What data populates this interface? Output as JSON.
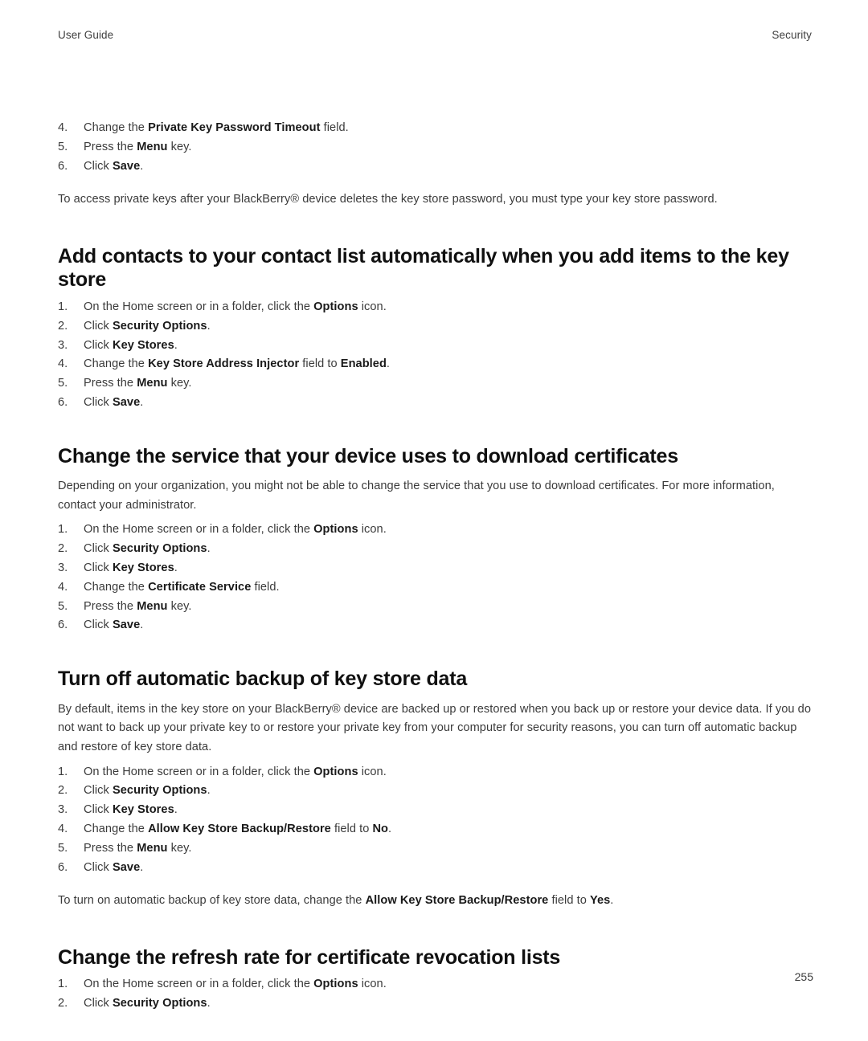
{
  "running_head": {
    "left": "User Guide",
    "right": "Security"
  },
  "page_number": "255",
  "sections": [
    {
      "id": "continued-steps",
      "heading": null,
      "steps": [
        {
          "num": "4.",
          "parts": [
            {
              "t": "Change the ",
              "b": false
            },
            {
              "t": "Private Key Password Timeout",
              "b": true
            },
            {
              "t": " field.",
              "b": false
            }
          ]
        },
        {
          "num": "5.",
          "parts": [
            {
              "t": "Press the ",
              "b": false
            },
            {
              "t": "Menu",
              "b": true
            },
            {
              "t": " key.",
              "b": false
            }
          ]
        },
        {
          "num": "6.",
          "parts": [
            {
              "t": "Click ",
              "b": false
            },
            {
              "t": "Save",
              "b": true
            },
            {
              "t": ".",
              "b": false
            }
          ]
        }
      ],
      "trailing_paragraph": "To access private keys after your BlackBerry® device deletes the key store password, you must type your key store password."
    },
    {
      "id": "add-contacts-automatically",
      "heading": "Add contacts to your contact list automatically when you add items to the key store",
      "intro": null,
      "steps": [
        {
          "num": "1.",
          "parts": [
            {
              "t": "On the Home screen or in a folder, click the ",
              "b": false
            },
            {
              "t": "Options",
              "b": true
            },
            {
              "t": " icon.",
              "b": false
            }
          ]
        },
        {
          "num": "2.",
          "parts": [
            {
              "t": "Click ",
              "b": false
            },
            {
              "t": "Security Options",
              "b": true
            },
            {
              "t": ".",
              "b": false
            }
          ]
        },
        {
          "num": "3.",
          "parts": [
            {
              "t": "Click ",
              "b": false
            },
            {
              "t": "Key Stores",
              "b": true
            },
            {
              "t": ".",
              "b": false
            }
          ]
        },
        {
          "num": "4.",
          "parts": [
            {
              "t": "Change the ",
              "b": false
            },
            {
              "t": "Key Store Address Injector",
              "b": true
            },
            {
              "t": " field to ",
              "b": false
            },
            {
              "t": "Enabled",
              "b": true
            },
            {
              "t": ".",
              "b": false
            }
          ]
        },
        {
          "num": "5.",
          "parts": [
            {
              "t": "Press the ",
              "b": false
            },
            {
              "t": "Menu",
              "b": true
            },
            {
              "t": " key.",
              "b": false
            }
          ]
        },
        {
          "num": "6.",
          "parts": [
            {
              "t": "Click ",
              "b": false
            },
            {
              "t": "Save",
              "b": true
            },
            {
              "t": ".",
              "b": false
            }
          ]
        }
      ],
      "trailing_paragraph": null
    },
    {
      "id": "change-certificate-download-service",
      "heading": "Change the service that your device uses to download certificates",
      "intro": "Depending on your organization, you might not be able to change the service that you use to download certificates. For more information, contact your administrator.",
      "steps": [
        {
          "num": "1.",
          "parts": [
            {
              "t": "On the Home screen or in a folder, click the ",
              "b": false
            },
            {
              "t": "Options",
              "b": true
            },
            {
              "t": " icon.",
              "b": false
            }
          ]
        },
        {
          "num": "2.",
          "parts": [
            {
              "t": "Click ",
              "b": false
            },
            {
              "t": "Security Options",
              "b": true
            },
            {
              "t": ".",
              "b": false
            }
          ]
        },
        {
          "num": "3.",
          "parts": [
            {
              "t": "Click ",
              "b": false
            },
            {
              "t": "Key Stores",
              "b": true
            },
            {
              "t": ".",
              "b": false
            }
          ]
        },
        {
          "num": "4.",
          "parts": [
            {
              "t": "Change the ",
              "b": false
            },
            {
              "t": "Certificate Service",
              "b": true
            },
            {
              "t": " field.",
              "b": false
            }
          ]
        },
        {
          "num": "5.",
          "parts": [
            {
              "t": "Press the ",
              "b": false
            },
            {
              "t": "Menu",
              "b": true
            },
            {
              "t": " key.",
              "b": false
            }
          ]
        },
        {
          "num": "6.",
          "parts": [
            {
              "t": "Click ",
              "b": false
            },
            {
              "t": "Save",
              "b": true
            },
            {
              "t": ".",
              "b": false
            }
          ]
        }
      ],
      "trailing_paragraph": null
    },
    {
      "id": "turn-off-automatic-backup",
      "heading": "Turn off automatic backup of key store data",
      "intro": "By default, items in the key store on your BlackBerry® device are backed up or restored when you back up or restore your device data. If you do not want to back up your private key to or restore your private key from your computer for security reasons, you can turn off automatic backup and restore of key store data.",
      "steps": [
        {
          "num": "1.",
          "parts": [
            {
              "t": "On the Home screen or in a folder, click the ",
              "b": false
            },
            {
              "t": "Options",
              "b": true
            },
            {
              "t": " icon.",
              "b": false
            }
          ]
        },
        {
          "num": "2.",
          "parts": [
            {
              "t": "Click ",
              "b": false
            },
            {
              "t": "Security Options",
              "b": true
            },
            {
              "t": ".",
              "b": false
            }
          ]
        },
        {
          "num": "3.",
          "parts": [
            {
              "t": "Click ",
              "b": false
            },
            {
              "t": "Key Stores",
              "b": true
            },
            {
              "t": ".",
              "b": false
            }
          ]
        },
        {
          "num": "4.",
          "parts": [
            {
              "t": "Change the ",
              "b": false
            },
            {
              "t": "Allow Key Store Backup/Restore",
              "b": true
            },
            {
              "t": " field to ",
              "b": false
            },
            {
              "t": "No",
              "b": true
            },
            {
              "t": ".",
              "b": false
            }
          ]
        },
        {
          "num": "5.",
          "parts": [
            {
              "t": "Press the ",
              "b": false
            },
            {
              "t": "Menu",
              "b": true
            },
            {
              "t": " key.",
              "b": false
            }
          ]
        },
        {
          "num": "6.",
          "parts": [
            {
              "t": "Click ",
              "b": false
            },
            {
              "t": "Save",
              "b": true
            },
            {
              "t": ".",
              "b": false
            }
          ]
        }
      ],
      "trailing_paragraph_parts": [
        {
          "t": "To turn on automatic backup of key store data, change the ",
          "b": false
        },
        {
          "t": "Allow Key Store Backup/Restore",
          "b": true
        },
        {
          "t": " field to ",
          "b": false
        },
        {
          "t": "Yes",
          "b": true
        },
        {
          "t": ".",
          "b": false
        }
      ]
    },
    {
      "id": "change-crl-refresh-rate",
      "heading": "Change the refresh rate for certificate revocation lists",
      "intro": null,
      "steps": [
        {
          "num": "1.",
          "parts": [
            {
              "t": "On the Home screen or in a folder, click the ",
              "b": false
            },
            {
              "t": "Options",
              "b": true
            },
            {
              "t": " icon.",
              "b": false
            }
          ]
        },
        {
          "num": "2.",
          "parts": [
            {
              "t": "Click ",
              "b": false
            },
            {
              "t": "Security Options",
              "b": true
            },
            {
              "t": ".",
              "b": false
            }
          ]
        }
      ],
      "trailing_paragraph": null
    }
  ]
}
